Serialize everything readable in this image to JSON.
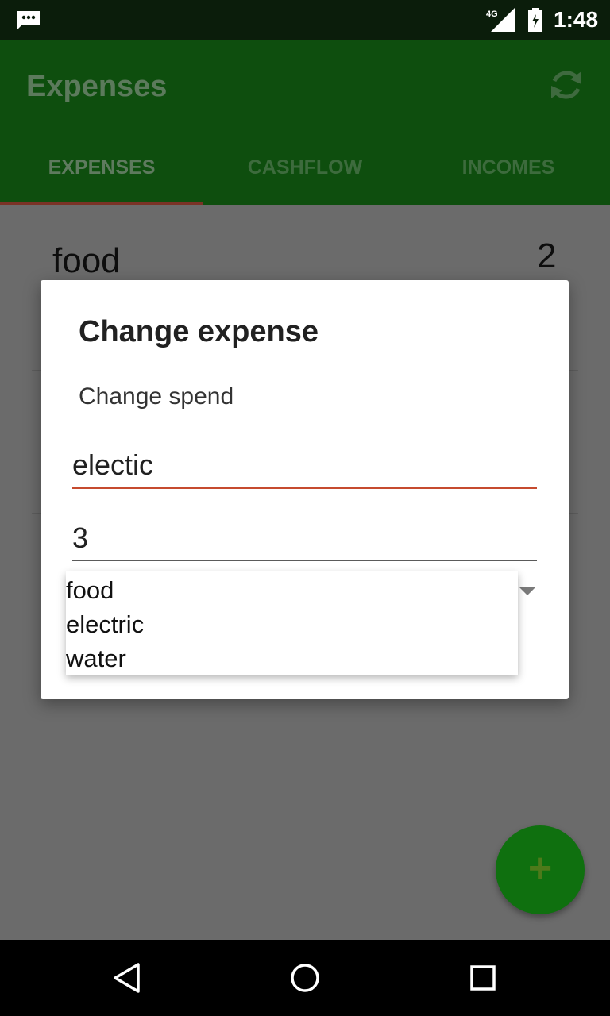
{
  "status_bar": {
    "time": "1:48",
    "network": "4G",
    "icons": [
      "message-icon",
      "signal-icon",
      "battery-icon"
    ]
  },
  "app_bar": {
    "title": "Expenses",
    "refresh_icon": "refresh-icon",
    "tabs": [
      {
        "label": "EXPENSES",
        "active": true
      },
      {
        "label": "CASHFLOW",
        "active": false
      },
      {
        "label": "INCOMES",
        "active": false
      }
    ]
  },
  "list": {
    "items": [
      {
        "name": "food",
        "value": "2"
      }
    ]
  },
  "dialog": {
    "title": "Change expense",
    "message": "Change spend",
    "name_value": "electic",
    "amount_value": "3"
  },
  "dropdown": {
    "options": [
      "food",
      "electric",
      "water"
    ]
  },
  "fab": {
    "label": "+"
  },
  "colors": {
    "app_bar": "#0e4e0e",
    "accent_underline": "#c64b2f",
    "fab": "#0f700f"
  }
}
